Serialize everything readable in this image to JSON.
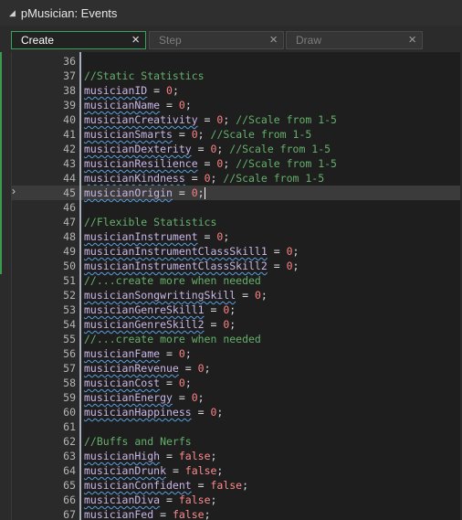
{
  "window": {
    "title": "pMusician: Events"
  },
  "tabs": [
    {
      "label": "Create",
      "close": "×",
      "active": true
    },
    {
      "label": "Step",
      "close": "×",
      "active": false
    },
    {
      "label": "Draw",
      "close": "×",
      "active": false
    }
  ],
  "editor": {
    "current_line": 45,
    "lines": [
      {
        "n": "36",
        "code": ""
      },
      {
        "n": "37",
        "code": "//Static Statistics"
      },
      {
        "n": "38",
        "code": "musicianID = 0;"
      },
      {
        "n": "39",
        "code": "musicianName = 0;"
      },
      {
        "n": "40",
        "code": "musicianCreativity = 0; //Scale from 1-5"
      },
      {
        "n": "41",
        "code": "musicianSmarts = 0; //Scale from 1-5"
      },
      {
        "n": "42",
        "code": "musicianDexterity = 0; //Scale from 1-5"
      },
      {
        "n": "43",
        "code": "musicianResilience = 0; //Scale from 1-5"
      },
      {
        "n": "44",
        "code": "musicianKindness = 0; //Scale from 1-5"
      },
      {
        "n": "45",
        "code": "musicianOrigin = 0;"
      },
      {
        "n": "46",
        "code": ""
      },
      {
        "n": "47",
        "code": "//Flexible Statistics"
      },
      {
        "n": "48",
        "code": "musicianInstrument = 0;"
      },
      {
        "n": "49",
        "code": "musicianInstrumentClassSkill1 = 0;"
      },
      {
        "n": "50",
        "code": "musicianInstrumentClassSkill2 = 0;"
      },
      {
        "n": "51",
        "code": "//...create more when needed"
      },
      {
        "n": "52",
        "code": "musicianSongwritingSkill = 0;"
      },
      {
        "n": "53",
        "code": "musicianGenreSkill1 = 0;"
      },
      {
        "n": "54",
        "code": "musicianGenreSkill2 = 0;"
      },
      {
        "n": "55",
        "code": "//...create more when needed"
      },
      {
        "n": "56",
        "code": "musicianFame = 0;"
      },
      {
        "n": "57",
        "code": "musicianRevenue = 0;"
      },
      {
        "n": "58",
        "code": "musicianCost = 0;"
      },
      {
        "n": "59",
        "code": "musicianEnergy = 0;"
      },
      {
        "n": "60",
        "code": "musicianHappiness = 0;"
      },
      {
        "n": "61",
        "code": ""
      },
      {
        "n": "62",
        "code": "//Buffs and Nerfs"
      },
      {
        "n": "63",
        "code": "musicianHigh = false;"
      },
      {
        "n": "64",
        "code": "musicianDrunk = false;"
      },
      {
        "n": "65",
        "code": "musicianConfident = false;"
      },
      {
        "n": "66",
        "code": "musicianDiva = false;"
      },
      {
        "n": "67",
        "code": "musicianFed = false;"
      }
    ]
  },
  "colors": {
    "accent": "#3aa35a",
    "identifier": "#c9b6e6",
    "number": "#ff8080",
    "comment": "#64b06a",
    "keyword": "#ff8a8a"
  }
}
